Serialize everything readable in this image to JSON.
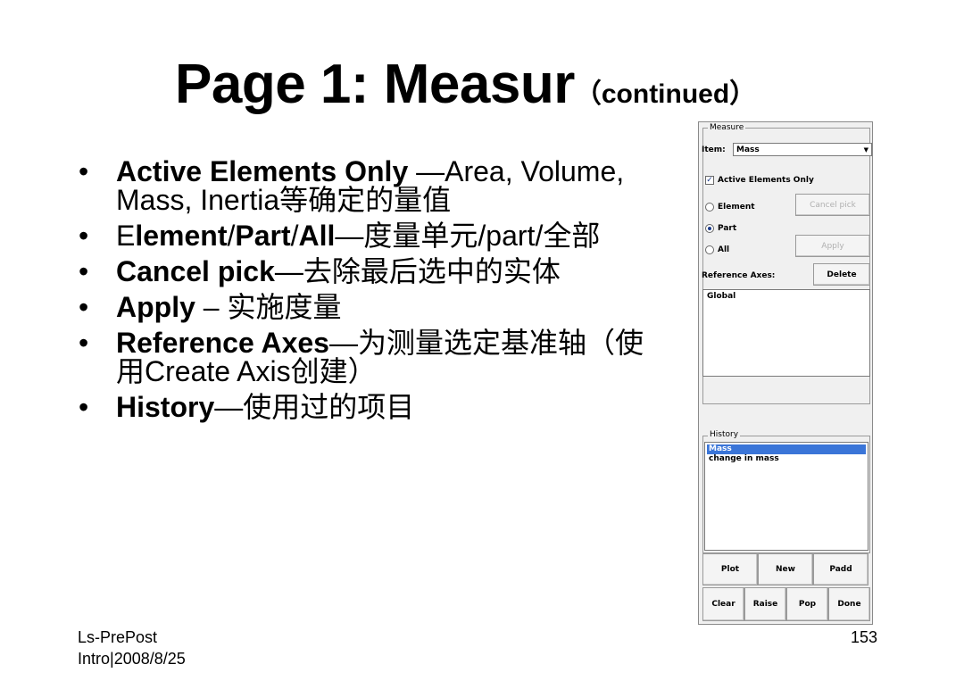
{
  "slide": {
    "title_main": "Page 1: Measur",
    "title_sub": "（continued）",
    "bullets": [
      {
        "bold": "Active Elements Only",
        "rest": " —Area, Volume, Mass, Inertia等确定的量值"
      },
      {
        "pre": "E",
        "bold": "lement",
        "mid1": "/",
        "bold2": "Part",
        "mid2": "/",
        "bold3": "All",
        "rest": "—度量单元/part/全部"
      },
      {
        "bold": "Cancel pick",
        "rest": "—去除最后选中的实体"
      },
      {
        "bold": "Apply",
        "rest": " – 实施度量"
      },
      {
        "bold": "Reference Axes",
        "rest": "—为测量选定基准轴（使用Create Axis创建）"
      },
      {
        "bold": "History",
        "rest": "—使用过的项目"
      }
    ],
    "bullet_glyph": "•",
    "footer_line1": "Ls-PrePost",
    "footer_line2": "Intro|2008/8/25",
    "page_number": "153"
  },
  "dialog": {
    "measure_group_title": "Measure",
    "item_label": "Item:",
    "item_value": "Mass",
    "combo_arrow_icon": "▼",
    "active_only_label": "Active Elements Only",
    "active_only_checked": true,
    "check_mark": "✓",
    "element_label": "Element",
    "part_label": "Part",
    "all_label": "All",
    "selected_mode": "Part",
    "cancel_pick_label": "Cancel pick",
    "apply_label": "Apply",
    "reference_axes_label": "Reference Axes:",
    "delete_label": "Delete",
    "axes_items": [
      "Global"
    ],
    "history_group_title": "History",
    "history_items": [
      "Mass",
      "change in mass"
    ],
    "history_selected": "Mass",
    "buttons_row1": [
      "Plot",
      "New",
      "Padd"
    ],
    "buttons_row2": [
      "Clear",
      "Raise",
      "Pop",
      "Done"
    ],
    "selection_color": "#3a75d8"
  }
}
